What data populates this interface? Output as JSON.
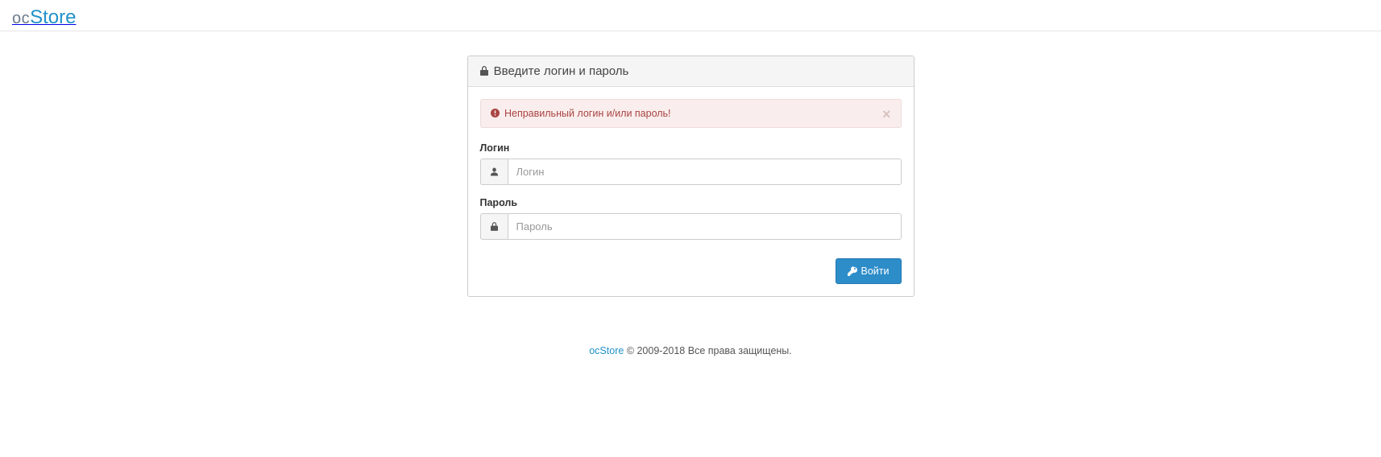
{
  "brand": {
    "prefix": "oc",
    "suffix": "Store"
  },
  "panel": {
    "title": "Введите логин и пароль"
  },
  "alert": {
    "message": "Неправильный логин и/или пароль!"
  },
  "form": {
    "username_label": "Логин",
    "username_placeholder": "Логин",
    "password_label": "Пароль",
    "password_placeholder": "Пароль",
    "submit_label": "Войти"
  },
  "footer": {
    "link_text": "ocStore",
    "copyright": " © 2009-2018 Все права защищены."
  }
}
